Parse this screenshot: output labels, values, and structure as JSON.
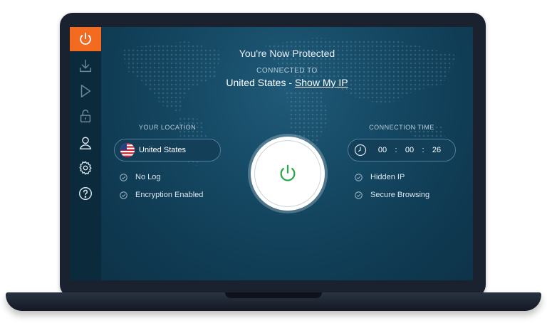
{
  "header": {
    "title": "You're Now Protected",
    "connected_label": "CONNECTED TO",
    "country": "United States",
    "separator": " - ",
    "show_ip": "Show My IP"
  },
  "sidebar": {
    "items": [
      {
        "icon": "power-icon",
        "active": true
      },
      {
        "icon": "download-icon",
        "active": false
      },
      {
        "icon": "play-icon",
        "active": false
      },
      {
        "icon": "lock-icon",
        "active": false
      },
      {
        "icon": "user-icon",
        "active": false
      },
      {
        "icon": "gear-icon",
        "active": false
      },
      {
        "icon": "help-icon",
        "active": false
      }
    ]
  },
  "location": {
    "label": "YOUR LOCATION",
    "value": "United States",
    "flag_icon": "us-flag-icon"
  },
  "left_features": [
    "No Log",
    "Encryption Enabled"
  ],
  "connection_time": {
    "label": "CONNECTION TIME",
    "hours": "00",
    "minutes": "00",
    "seconds": "26",
    "separator": ":"
  },
  "right_features": [
    "Hidden IP",
    "Secure Browsing"
  ],
  "colors": {
    "accent": "#f26b21",
    "power_green": "#2aa84a",
    "background": "#0f3a52"
  }
}
